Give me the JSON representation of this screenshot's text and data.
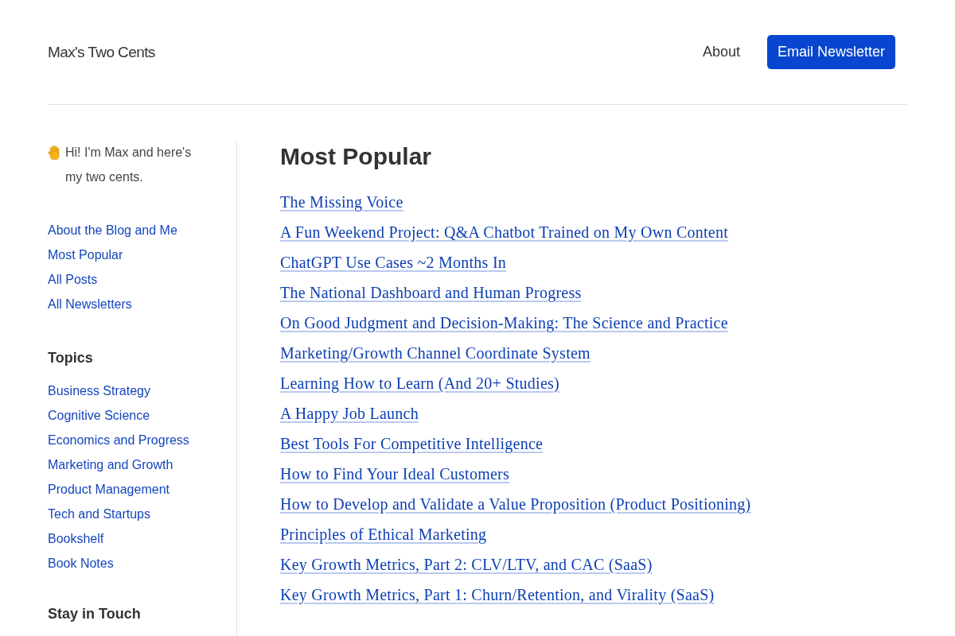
{
  "header": {
    "site_title": "Max's Two Cents",
    "nav": [
      {
        "label": "About",
        "kind": "link"
      },
      {
        "label": "Email Newsletter",
        "kind": "button"
      }
    ]
  },
  "sidebar": {
    "intro": "Hi! I'm Max and here's my two cents.",
    "links": [
      "About the Blog and Me",
      "Most Popular",
      "All Posts",
      "All Newsletters"
    ],
    "topics_heading": "Topics",
    "topics": [
      "Business Strategy",
      "Cognitive Science",
      "Economics and Progress",
      "Marketing and Growth",
      "Product Management",
      "Tech and Startups",
      "Bookshelf",
      "Book Notes"
    ],
    "stay_heading": "Stay in Touch"
  },
  "main": {
    "heading": "Most Popular",
    "posts": [
      "The Missing Voice",
      "A Fun Weekend Project: Q&A Chatbot Trained on My Own Content",
      "ChatGPT Use Cases ~2 Months In",
      "The National Dashboard and Human Progress",
      "On Good Judgment and Decision-Making: The Science and Practice",
      "Marketing/Growth Channel Coordinate System",
      "Learning How to Learn (And 20+ Studies)",
      "A Happy Job Launch",
      "Best Tools For Competitive Intelligence",
      "How to Find Your Ideal Customers",
      "How to Develop and Validate a Value Proposition (Product Positioning)",
      "Principles of Ethical Marketing",
      "Key Growth Metrics, Part 2: CLV/LTV, and CAC (SaaS)",
      "Key Growth Metrics, Part 1: Churn/Retention, and Virality (SaaS)"
    ]
  }
}
